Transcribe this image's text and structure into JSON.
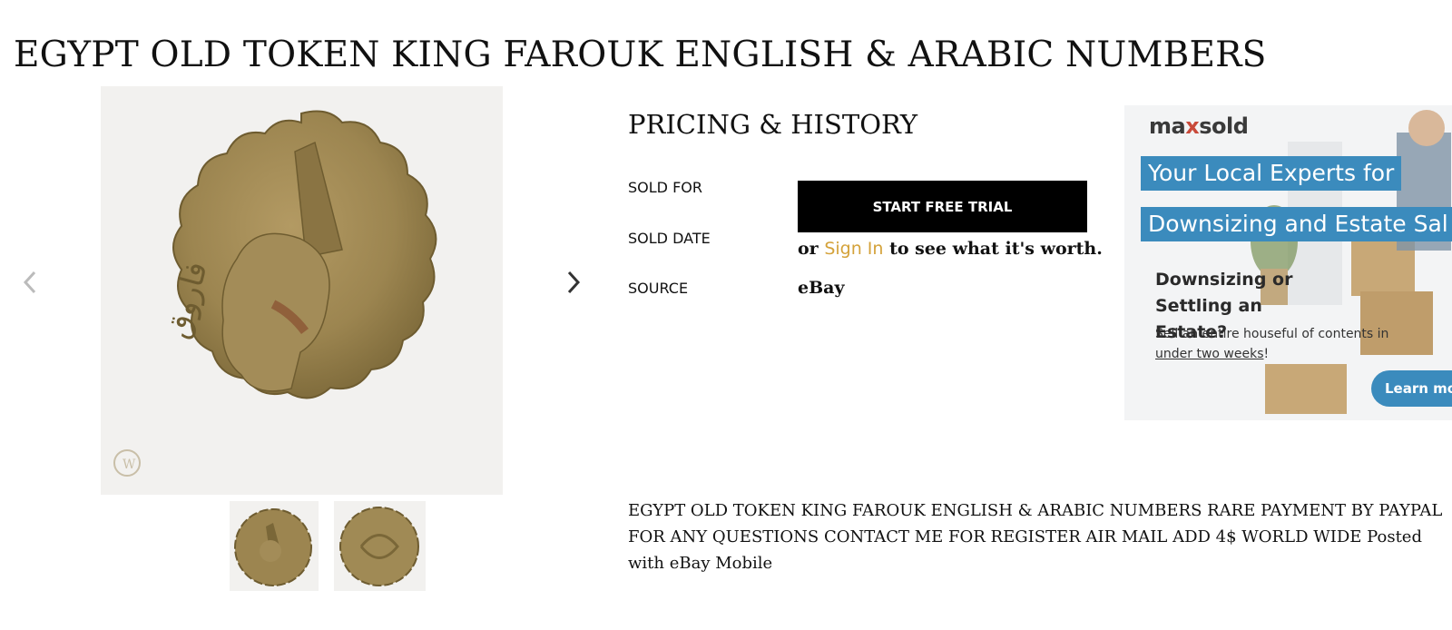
{
  "item": {
    "title": "EGYPT OLD TOKEN KING FAROUK ENGLISH & ARABIC NUMBERS",
    "description": "EGYPT OLD TOKEN KING FAROUK ENGLISH & ARABIC NUMBERS RARE PAYMENT BY PAYPAL FOR ANY QUESTIONS CONTACT ME FOR REGISTER AIR MAIL ADD 4$ WORLD WIDE Posted with eBay Mobile"
  },
  "gallery": {
    "main_image_icon": "coin-photo",
    "prev_icon": "chevron-left-icon",
    "next_icon": "chevron-right-icon",
    "thumbnails": [
      "coin-obverse-thumbnail",
      "coin-reverse-thumbnail"
    ],
    "watermark": "W",
    "arabic_text": "فاروق"
  },
  "pricing": {
    "heading": "PRICING & HISTORY",
    "labels": {
      "sold_for": "SOLD FOR",
      "sold_date": "SOLD DATE",
      "source": "SOURCE"
    },
    "trial_button": "START FREE TRIAL",
    "signin_prefix": "or ",
    "signin_link": "Sign In",
    "signin_suffix": " to see what it's worth.",
    "source_value": "eBay"
  },
  "ad": {
    "logo_pre": "ma",
    "logo_x": "x",
    "logo_post": "sold",
    "band1": "Your Local Experts for",
    "band2": "Downsizing and Estate Sal",
    "sub": "Downsizing or Settling an Estate?",
    "body_pre": "Sell an entire houseful of contents in ",
    "body_link": "under two weeks",
    "body_post": "!",
    "cta": "Learn mo"
  },
  "colors": {
    "accent_link": "#d4a23a",
    "button_bg": "#000000",
    "ad_blue": "#3b8bbd",
    "coin_brass": "#9c8550"
  }
}
